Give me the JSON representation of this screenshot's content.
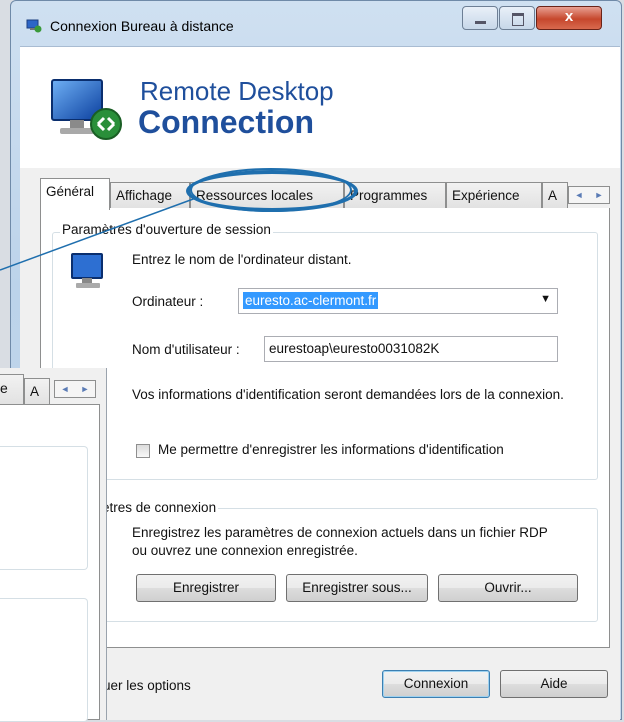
{
  "window": {
    "title": "Connexion Bureau à distance",
    "close_glyph": "x",
    "accent": "#1f4f9c"
  },
  "header": {
    "line1": "Remote Desktop",
    "line2": "Connection",
    "icon": "remote-desktop-icon"
  },
  "tabs": [
    {
      "label": "Général",
      "active": true
    },
    {
      "label": "Affichage"
    },
    {
      "label": "Ressources locales"
    },
    {
      "label": "Programmes"
    },
    {
      "label": "Expérience"
    },
    {
      "label": "A"
    }
  ],
  "session": {
    "legend": "Paramètres d'ouverture de session",
    "instruction": "Entrez le nom de l'ordinateur distant.",
    "computer_label": "Ordinateur :",
    "computer_value": "euresto.ac-clermont.fr",
    "user_label": "Nom d'utilisateur :",
    "user_value": "eurestoap\\euresto0031082K",
    "info_text": "Vos informations d'identification seront demandées lors de la connexion.",
    "remember_label": "Me permettre d'enregistrer les informations d'identification"
  },
  "connection_settings": {
    "legend": "ètres de connexion",
    "description": "Enregistrez les paramètres de connexion actuels dans un fichier RDP ou ouvrez une connexion enregistrée.",
    "save_label": "Enregistrer",
    "save_as_label": "Enregistrer sous...",
    "open_label": "Ouvrir..."
  },
  "footer": {
    "options_label": "juer les options",
    "connect_label": "Connexion",
    "help_label": "Aide"
  },
  "overlay_window": {
    "tab_fragment": "e",
    "tab_fragment2": "A"
  }
}
